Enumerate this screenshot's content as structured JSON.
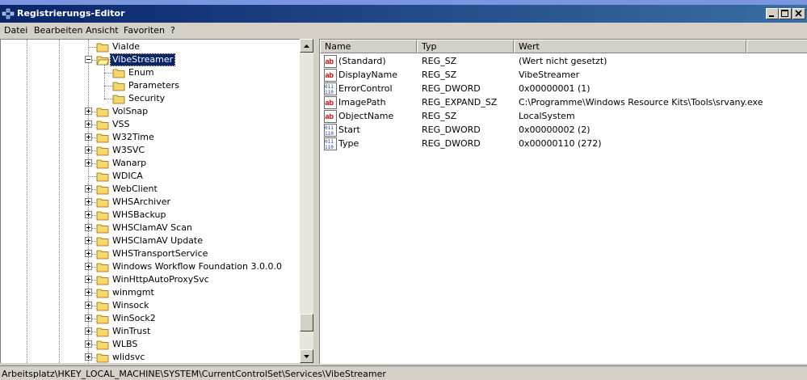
{
  "window": {
    "title": "Registrierungs-Editor"
  },
  "menu": [
    {
      "label": "Datei"
    },
    {
      "label": "Bearbeiten"
    },
    {
      "label": "Ansicht"
    },
    {
      "label": "Favoriten"
    },
    {
      "label": "?"
    }
  ],
  "tree": {
    "items": [
      {
        "label": "ViaIde",
        "level": 1,
        "expander": "none",
        "selected": false
      },
      {
        "label": "VibeStreamer",
        "level": 1,
        "expander": "minus",
        "selected": true,
        "open": true
      },
      {
        "label": "Enum",
        "level": 2,
        "expander": "none",
        "selected": false
      },
      {
        "label": "Parameters",
        "level": 2,
        "expander": "none",
        "selected": false
      },
      {
        "label": "Security",
        "level": 2,
        "expander": "none",
        "selected": false
      },
      {
        "label": "VolSnap",
        "level": 1,
        "expander": "plus",
        "selected": false
      },
      {
        "label": "VSS",
        "level": 1,
        "expander": "plus",
        "selected": false
      },
      {
        "label": "W32Time",
        "level": 1,
        "expander": "plus",
        "selected": false
      },
      {
        "label": "W3SVC",
        "level": 1,
        "expander": "plus",
        "selected": false
      },
      {
        "label": "Wanarp",
        "level": 1,
        "expander": "plus",
        "selected": false
      },
      {
        "label": "WDICA",
        "level": 1,
        "expander": "none",
        "selected": false
      },
      {
        "label": "WebClient",
        "level": 1,
        "expander": "plus",
        "selected": false
      },
      {
        "label": "WHSArchiver",
        "level": 1,
        "expander": "plus",
        "selected": false
      },
      {
        "label": "WHSBackup",
        "level": 1,
        "expander": "plus",
        "selected": false
      },
      {
        "label": "WHSClamAV Scan",
        "level": 1,
        "expander": "plus",
        "selected": false
      },
      {
        "label": "WHSClamAV Update",
        "level": 1,
        "expander": "plus",
        "selected": false
      },
      {
        "label": "WHSTransportService",
        "level": 1,
        "expander": "plus",
        "selected": false
      },
      {
        "label": "Windows Workflow Foundation 3.0.0.0",
        "level": 1,
        "expander": "plus",
        "selected": false
      },
      {
        "label": "WinHttpAutoProxySvc",
        "level": 1,
        "expander": "plus",
        "selected": false
      },
      {
        "label": "winmgmt",
        "level": 1,
        "expander": "plus",
        "selected": false
      },
      {
        "label": "Winsock",
        "level": 1,
        "expander": "plus",
        "selected": false
      },
      {
        "label": "WinSock2",
        "level": 1,
        "expander": "plus",
        "selected": false
      },
      {
        "label": "WinTrust",
        "level": 1,
        "expander": "plus",
        "selected": false
      },
      {
        "label": "WLBS",
        "level": 1,
        "expander": "plus",
        "selected": false
      },
      {
        "label": "wlidsvc",
        "level": 1,
        "expander": "plus",
        "selected": false
      }
    ]
  },
  "list": {
    "columns": [
      {
        "label": "Name"
      },
      {
        "label": "Typ"
      },
      {
        "label": "Wert"
      }
    ],
    "rows": [
      {
        "name": "(Standard)",
        "type": "REG_SZ",
        "value": "(Wert nicht gesetzt)",
        "icon": "string-value-icon"
      },
      {
        "name": "DisplayName",
        "type": "REG_SZ",
        "value": "VibeStreamer",
        "icon": "string-value-icon"
      },
      {
        "name": "ErrorControl",
        "type": "REG_DWORD",
        "value": "0x00000001 (1)",
        "icon": "binary-value-icon"
      },
      {
        "name": "ImagePath",
        "type": "REG_EXPAND_SZ",
        "value": "C:\\Programme\\Windows Resource Kits\\Tools\\srvany.exe",
        "icon": "string-value-icon"
      },
      {
        "name": "ObjectName",
        "type": "REG_SZ",
        "value": "LocalSystem",
        "icon": "string-value-icon"
      },
      {
        "name": "Start",
        "type": "REG_DWORD",
        "value": "0x00000002 (2)",
        "icon": "binary-value-icon"
      },
      {
        "name": "Type",
        "type": "REG_DWORD",
        "value": "0x00000110 (272)",
        "icon": "binary-value-icon"
      }
    ]
  },
  "status": {
    "path": "Arbeitsplatz\\HKEY_LOCAL_MACHINE\\SYSTEM\\CurrentControlSet\\Services\\VibeStreamer"
  },
  "colors": {
    "titlebar": "#0a246a",
    "selection": "#0a246a",
    "face": "#d4d0c8",
    "folder": "#f5d76e"
  }
}
